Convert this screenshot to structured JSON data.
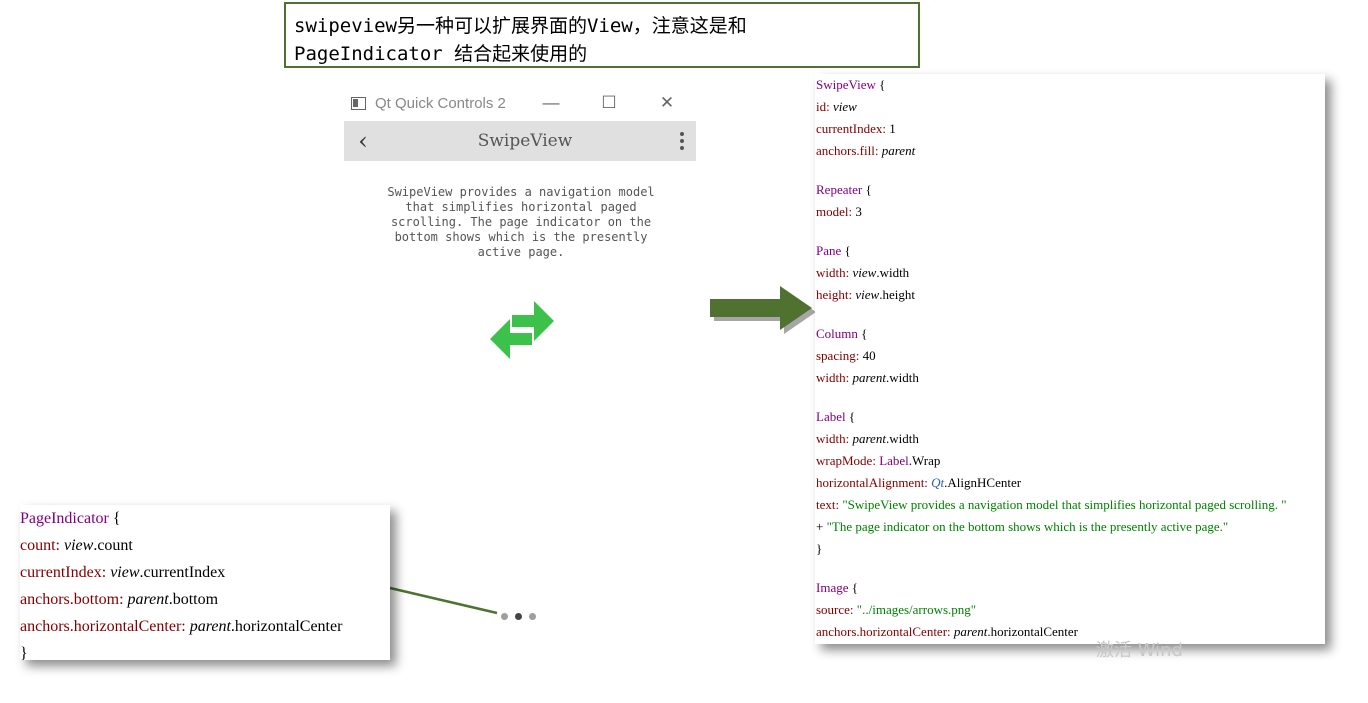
{
  "annotation": {
    "line1": "swipeview另一种可以扩展界面的View，注意这是和",
    "line2": "PageIndicator 结合起来使用的"
  },
  "window": {
    "title": "Qt Quick Controls 2",
    "minimize": "—",
    "maximize": "☐",
    "close": "✕"
  },
  "toolbar": {
    "back": "‹",
    "title": "SwipeView"
  },
  "label": {
    "lines": [
      "SwipeView provides a navigation model",
      "that simplifies horizontal paged",
      "scrolling. The page indicator on the",
      "bottom shows which is the presently",
      "active page."
    ]
  },
  "page_indicator": {
    "count": 3,
    "current_index": 1
  },
  "code_right": {
    "l01": "SwipeView",
    "l02a": "id: ",
    "l02b": "view",
    "l03a": "currentIndex: ",
    "l03b": "1",
    "l04a": "anchors.fill: ",
    "l04b": "parent",
    "l05": "Repeater",
    "l06a": "model: ",
    "l06b": "3",
    "l07": "Pane",
    "l08a": "width: ",
    "l08b": "view",
    "l08c": ".width",
    "l09a": "height: ",
    "l09b": "view",
    "l09c": ".height",
    "l10": "Column",
    "l11a": "spacing: ",
    "l11b": "40",
    "l12a": "width: ",
    "l12b": "parent",
    "l12c": ".width",
    "l13": "Label",
    "l14a": "width: ",
    "l14b": "parent",
    "l14c": ".width",
    "l15a": "wrapMode: ",
    "l15b": "Label",
    "l15c": ".Wrap",
    "l16a": "horizontalAlignment: ",
    "l16b": "Qt",
    "l16c": ".AlignHCenter",
    "l17a": "text: ",
    "l17b": "\"SwipeView provides a navigation model that simplifies horizontal paged scrolling. \"",
    "l18a": "+ ",
    "l18b": "\"The page indicator on the bottom shows which is the presently active page.\"",
    "l19": "}",
    "l20": "Image",
    "l21a": "source: ",
    "l21b": "\"../images/arrows.png\"",
    "l22a": "anchors.horizontalCenter: ",
    "l22b": "parent",
    "l22c": ".horizontalCenter",
    "brace_open": " {"
  },
  "code_left": {
    "l1": "PageIndicator",
    "l2a": "count: ",
    "l2b": "view",
    "l2c": ".count",
    "l3a": "currentIndex: ",
    "l3b": "view",
    "l3c": ".currentIndex",
    "l4a": "anchors.bottom: ",
    "l4b": "parent",
    "l4c": ".bottom",
    "l5a": "anchors.horizontalCenter: ",
    "l5b": "parent",
    "l5c": ".horizontalCenter",
    "l6": "}",
    "brace_open": " {"
  },
  "watermark": "激活 Wind",
  "colors": {
    "annotation_border": "#4f7230",
    "arrow_green": "#4f7230",
    "icon_green": "#3cc24a",
    "keyword": "#800080",
    "property": "#800000",
    "string": "#008000",
    "toolbar_bg": "#e0e0e0"
  }
}
